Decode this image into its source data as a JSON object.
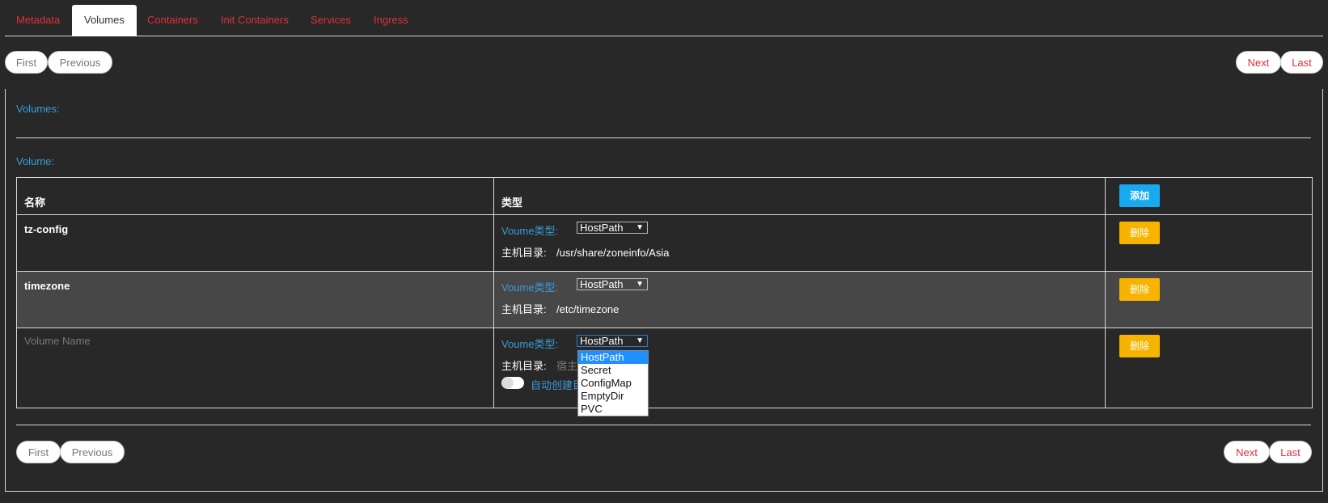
{
  "tabs": [
    {
      "label": "Metadata",
      "active": false
    },
    {
      "label": "Volumes",
      "active": true
    },
    {
      "label": "Containers",
      "active": false
    },
    {
      "label": "Init Containers",
      "active": false
    },
    {
      "label": "Services",
      "active": false
    },
    {
      "label": "Ingress",
      "active": false
    }
  ],
  "pagination": {
    "first": "First",
    "previous": "Previous",
    "next": "Next",
    "last": "Last"
  },
  "section": {
    "volumes_label": "Volumes:",
    "volume_label": "Volume:"
  },
  "table": {
    "headers": {
      "name": "名称",
      "type": "类型"
    },
    "add_button": "添加",
    "delete_button": "删除",
    "type_label": "Voume类型:",
    "hostdir_label": "主机目录:",
    "rows": [
      {
        "name": "tz-config",
        "type": "HostPath",
        "host_dir": "/usr/share/zoneinfo/Asia"
      },
      {
        "name": "timezone",
        "type": "HostPath",
        "host_dir": "/etc/timezone"
      }
    ],
    "new_row": {
      "name_placeholder": "Volume Name",
      "type": "HostPath",
      "host_dir_placeholder": "宿主",
      "auto_create_label": "自动创建目"
    }
  },
  "type_options": [
    "HostPath",
    "Secret",
    "ConfigMap",
    "EmptyDir",
    "PVC"
  ],
  "colors": {
    "background": "#282828",
    "accent_red": "#e0303a",
    "accent_blue": "#3a9ad9",
    "add_button": "#18aaf0",
    "delete_button": "#f6b400",
    "selected_option": "#1e90ff"
  }
}
